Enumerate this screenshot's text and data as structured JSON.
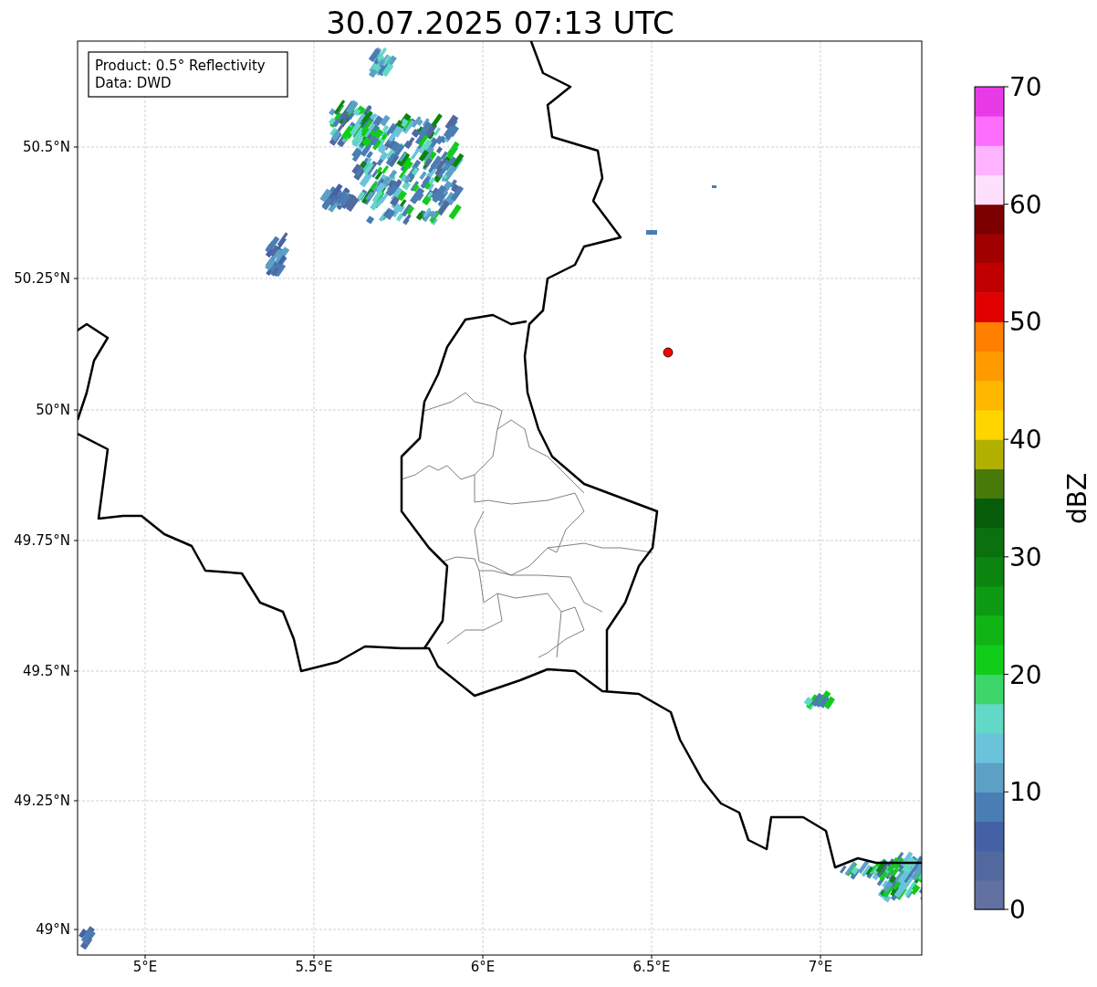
{
  "title": "30.07.2025 07:13 UTC",
  "info_box": {
    "lines": [
      "Product: 0.5° Reflectivity",
      "Data: DWD"
    ]
  },
  "map": {
    "x_tick_labels": [
      "5°E",
      "5.5°E",
      "6°E",
      "6.5°E",
      "7°E"
    ],
    "y_tick_labels": [
      "50.5°N",
      "50.25°N",
      "50°N",
      "49.75°N",
      "49.5°N",
      "49.25°N",
      "49°N"
    ]
  },
  "colorbar": {
    "label": "dBZ",
    "ticks": [
      "70",
      "60",
      "50",
      "40",
      "30",
      "20",
      "10",
      "0"
    ],
    "bins": [
      {
        "color": "#6270a2"
      },
      {
        "color": "#51699f"
      },
      {
        "color": "#4461a6"
      },
      {
        "color": "#4a7db3"
      },
      {
        "color": "#5ca0c6"
      },
      {
        "color": "#6ac3db"
      },
      {
        "color": "#62d8c6"
      },
      {
        "color": "#3dd66a"
      },
      {
        "color": "#11cd19"
      },
      {
        "color": "#10b515"
      },
      {
        "color": "#0e9b13"
      },
      {
        "color": "#0b850f"
      },
      {
        "color": "#0b700e"
      },
      {
        "color": "#075d0a"
      },
      {
        "color": "#487a0a"
      },
      {
        "color": "#b1b000"
      },
      {
        "color": "#ffd500"
      },
      {
        "color": "#ffb700"
      },
      {
        "color": "#ff9a00"
      },
      {
        "color": "#ff7f00"
      },
      {
        "color": "#e10000"
      },
      {
        "color": "#c00000"
      },
      {
        "color": "#a00000"
      },
      {
        "color": "#7c0000"
      },
      {
        "color": "#fee0fe"
      },
      {
        "color": "#feb3fe"
      },
      {
        "color": "#fe6dfe"
      },
      {
        "color": "#e93ae8"
      }
    ]
  }
}
